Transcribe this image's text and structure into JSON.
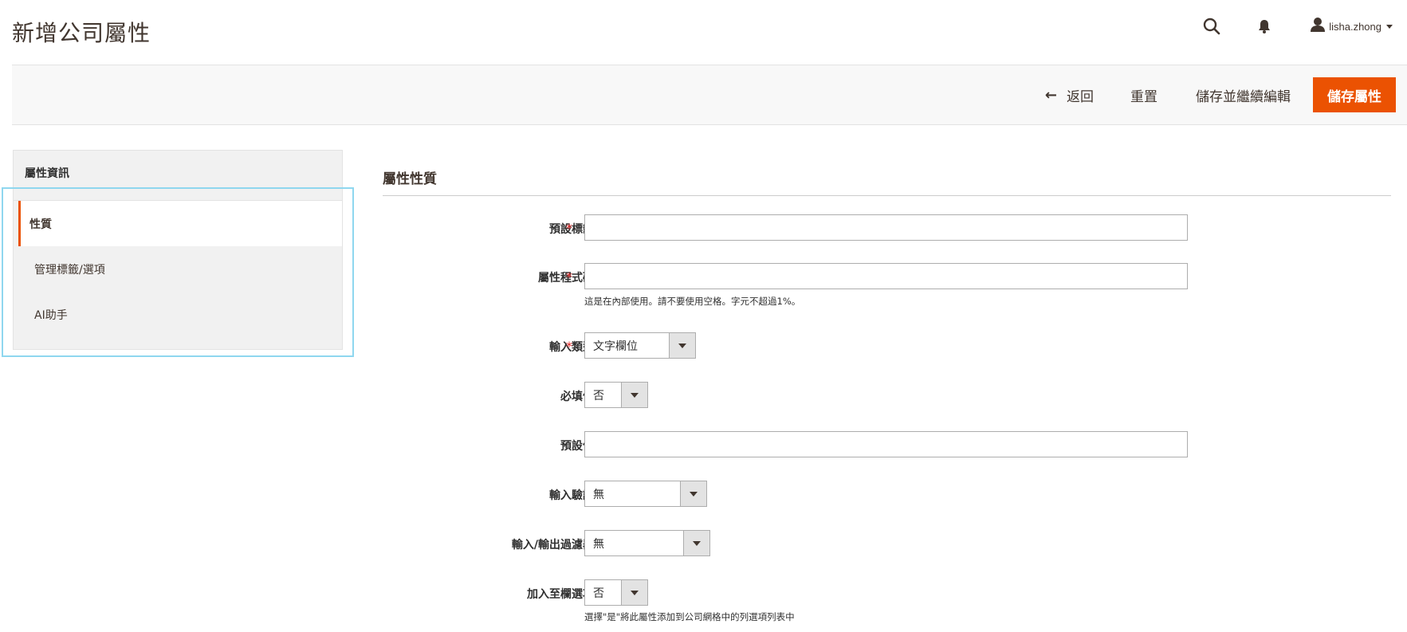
{
  "header": {
    "title": "新增公司屬性",
    "user_name": "lisha.zhong",
    "icons": {
      "search": "search-icon",
      "notifications": "bell-icon",
      "user": "user-icon"
    }
  },
  "toolbar": {
    "back_label": "返回",
    "reset_label": "重置",
    "save_continue_label": "儲存並繼續編輯",
    "save_label": "儲存屬性",
    "accent_color": "#eb5202"
  },
  "sidebar": {
    "heading": "屬性資訊",
    "tabs": [
      {
        "label": "性質",
        "active": true
      },
      {
        "label": "管理標籤/選項",
        "active": false
      },
      {
        "label": "AI助手",
        "active": false
      }
    ]
  },
  "form": {
    "section_title": "屬性性質",
    "fields": {
      "default_label": {
        "label": "預設標籤",
        "value": "",
        "required": true
      },
      "attribute_code": {
        "label": "屬性程式碼",
        "value": "",
        "required": true,
        "note": "這是在內部使用。請不要使用空格。字元不超過1%。"
      },
      "input_type": {
        "label": "輸入類型",
        "value": "文字欄位",
        "required": true
      },
      "values_required": {
        "label": "必填值",
        "value": "否"
      },
      "default_value": {
        "label": "預設值",
        "value": ""
      },
      "input_validation": {
        "label": "輸入驗證",
        "value": "無"
      },
      "input_output_filter": {
        "label": "輸入/輸出過濾器",
        "value": "無"
      },
      "add_to_column_options": {
        "label": "加入至欄選項",
        "value": "否",
        "note": "選擇\"是\"將此屬性添加到公司網格中的列選項列表中"
      }
    },
    "required_mark": "*"
  }
}
